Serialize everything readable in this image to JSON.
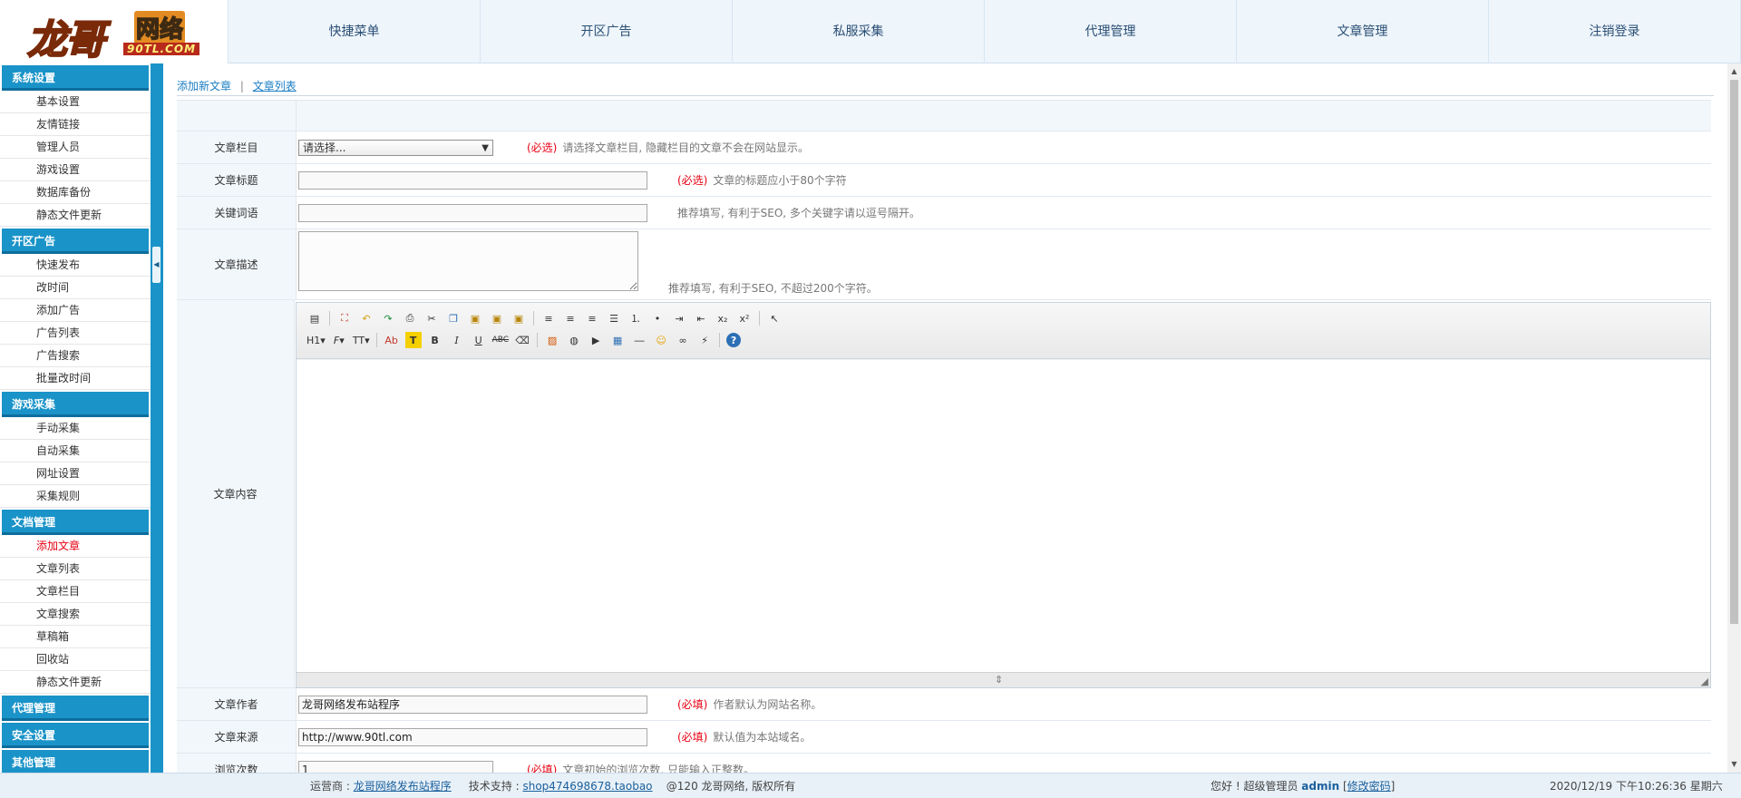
{
  "logo": {
    "main": "龙哥",
    "side": "网络",
    "domain": "90TL.COM"
  },
  "topnav": [
    "快捷菜单",
    "开区广告",
    "私服采集",
    "代理管理",
    "文章管理",
    "注销登录"
  ],
  "sidebar": {
    "sections": [
      {
        "title": "系统设置",
        "items": [
          "基本设置",
          "友情链接",
          "管理人员",
          "游戏设置",
          "数据库备份",
          "静态文件更新"
        ]
      },
      {
        "title": "开区广告",
        "items": [
          "快速发布",
          "改时间",
          "添加广告",
          "广告列表",
          "广告搜索",
          "批量改时间"
        ]
      },
      {
        "title": "游戏采集",
        "items": [
          "手动采集",
          "自动采集",
          "网址设置",
          "采集规则"
        ]
      },
      {
        "title": "文档管理",
        "items": [
          "添加文章",
          "文章列表",
          "文章栏目",
          "文章搜索",
          "草稿箱",
          "回收站",
          "静态文件更新"
        ]
      },
      {
        "title": "代理管理",
        "items": []
      },
      {
        "title": "安全设置",
        "items": []
      },
      {
        "title": "其他管理",
        "items": []
      }
    ],
    "active_item": "添加文章"
  },
  "crumbs": {
    "add": "添加新文章",
    "sep": "|",
    "list": "文章列表"
  },
  "form": {
    "category": {
      "label": "文章栏目",
      "selected": "请选择...",
      "req": "(必选)",
      "hint": "请选择文章栏目, 隐藏栏目的文章不会在网站显示。"
    },
    "title": {
      "label": "文章标题",
      "value": "",
      "req": "(必选)",
      "hint": "文章的标题应小于80个字符"
    },
    "keywords": {
      "label": "关键词语",
      "value": "",
      "hint": "推荐填写, 有利于SEO, 多个关键字请以逗号隔开。"
    },
    "description": {
      "label": "文章描述",
      "hint": "推荐填写, 有利于SEO, 不超过200个字符。"
    },
    "content": {
      "label": "文章内容"
    },
    "author": {
      "label": "文章作者",
      "value": "龙哥网络发布站程序",
      "req": "(必填)",
      "hint": "作者默认为网站名称。"
    },
    "source": {
      "label": "文章来源",
      "value": "http://www.90tl.com",
      "req": "(必填)",
      "hint": "默认值为本站域名。"
    },
    "views": {
      "label": "浏览次数",
      "value": "1",
      "req": "(必填)",
      "hint": "文章初始的浏览次数, 只能输入正整数。"
    }
  },
  "toolbar": {
    "heading": "H1",
    "font": "F",
    "size": "TT",
    "fontcolor": "Ab",
    "bgcolor": "T",
    "bold": "B",
    "italic": "I",
    "underline": "U",
    "strike": "ABC",
    "sub": "x₂",
    "sup": "x²",
    "help": "?"
  },
  "footer": {
    "op_label": "运营商 :",
    "op_link": "龙哥网络发布站程序",
    "tech_label": "技术支持 :",
    "tech_link": "shop474698678.taobao",
    "copyright": "@120 龙哥网络, 版权所有",
    "greet": "您好 ! 超级管理员",
    "admin": "admin",
    "bracket_open": "[",
    "change_pwd": "修改密码",
    "bracket_close": "]",
    "datetime": "2020/12/19 下午10:26:36 星期六"
  }
}
